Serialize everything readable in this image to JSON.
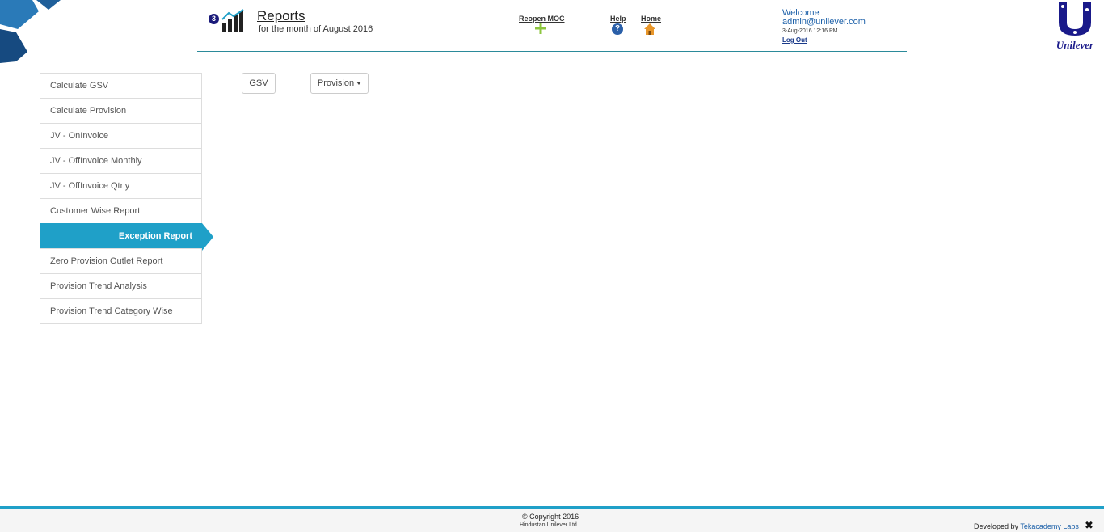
{
  "header": {
    "badge_count": "3",
    "title": "Reports",
    "subtitle": "for the month of August 2016",
    "reopen_label": "Reopen MOC",
    "help_label": "Help",
    "home_label": "Home",
    "welcome": "Welcome",
    "email": "admin@unilever.com",
    "datetime": "3-Aug-2016 12:16 PM",
    "logout": "Log Out",
    "logo_text": "Unilever"
  },
  "sidebar": {
    "items": [
      {
        "label": "Calculate GSV"
      },
      {
        "label": "Calculate Provision"
      },
      {
        "label": "JV - OnInvoice"
      },
      {
        "label": "JV - OffInvoice Monthly"
      },
      {
        "label": "JV - OffInvoice Qtrly"
      },
      {
        "label": "Customer Wise Report"
      },
      {
        "label": "Exception Report"
      },
      {
        "label": "Zero Provision Outlet Report"
      },
      {
        "label": "Provision Trend Analysis"
      },
      {
        "label": "Provision Trend Category Wise"
      }
    ],
    "active_index": 6
  },
  "main": {
    "gsv_button": "GSV",
    "provision_button": "Provision"
  },
  "footer": {
    "copyright": "Copyright 2016",
    "company": "Hindustan Unilever Ltd.",
    "developed_by": "Developed by",
    "developer": "Tekacademy Labs",
    "close": "✖"
  },
  "colors": {
    "accent": "#1fa0c8",
    "header_rule": "#2b8a9a",
    "link_blue": "#1a5fa8",
    "logo_blue": "#1a1a8a"
  },
  "icons": {
    "report": "bar-chart-icon",
    "reopen": "plus-icon",
    "help": "question-icon",
    "home": "home-icon",
    "close": "close-icon"
  }
}
